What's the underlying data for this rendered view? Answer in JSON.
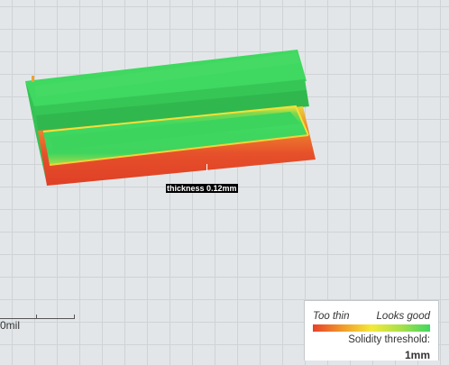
{
  "viewport": {
    "tooltip": "thickness 0.12mm"
  },
  "scale_bar": {
    "label": "0mil"
  },
  "legend": {
    "too_thin_label": "Too thin",
    "looks_good_label": "Looks good",
    "threshold_label": "Solidity threshold:",
    "threshold_value": "1mm",
    "gradient_colors": [
      "#e8412a",
      "#f09a2a",
      "#f4e93a",
      "#a9e04a",
      "#3fd860"
    ]
  },
  "colors": {
    "good": "#3fd860",
    "thin": "#e8412a",
    "background": "#e3e6e8"
  }
}
